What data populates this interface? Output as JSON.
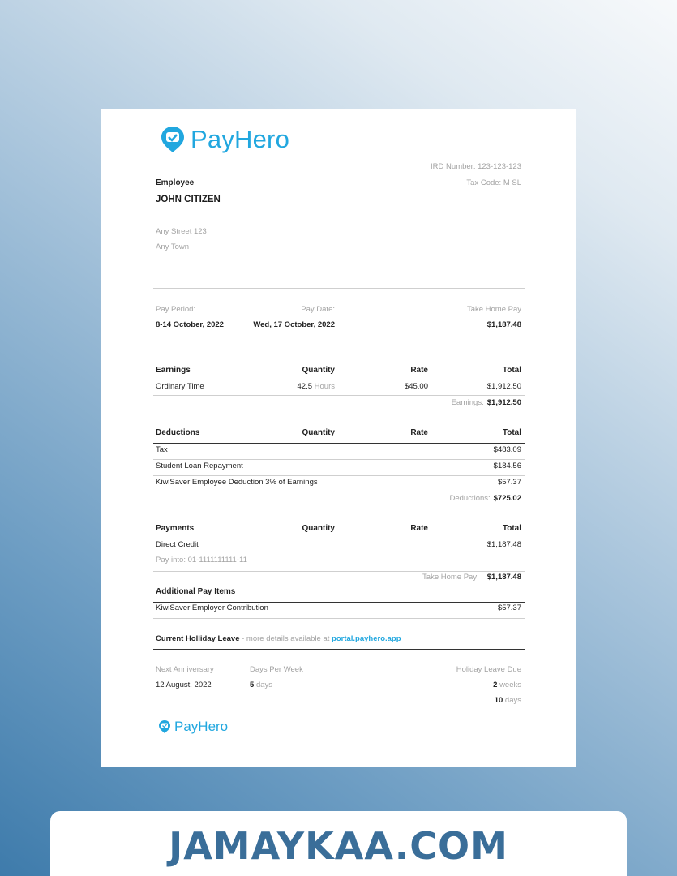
{
  "brand": {
    "name": "PayHero",
    "accent": "#21a7df"
  },
  "employee": {
    "label": "Employee",
    "name": "JOHN CITIZEN",
    "address_line1": "Any Street 123",
    "address_line2": "Any Town"
  },
  "tax": {
    "ird": "IRD Number: 123-123-123",
    "code": "Tax Code: M SL"
  },
  "period": {
    "pay_period_label": "Pay Period:",
    "pay_period_value": "8-14 October, 2022",
    "pay_date_label": "Pay Date:",
    "pay_date_value": "Wed, 17 October, 2022",
    "take_home_label": "Take Home Pay",
    "take_home_value": "$1,187.48"
  },
  "earnings": {
    "headers": [
      "Earnings",
      "Quantity",
      "Rate",
      "Total"
    ],
    "rows": [
      {
        "desc": "Ordinary Time",
        "qty": "42.5",
        "qty_unit": "Hours",
        "rate": "$45.00",
        "total": "$1,912.50"
      }
    ],
    "subtotal_label": "Earnings:",
    "subtotal_value": "$1,912.50"
  },
  "deductions": {
    "headers": [
      "Deductions",
      "Quantity",
      "Rate",
      "Total"
    ],
    "rows": [
      {
        "desc": "Tax",
        "total": "$483.09"
      },
      {
        "desc": "Student Loan Repayment",
        "total": "$184.56"
      },
      {
        "desc": "KiwiSaver Employee Deduction 3% of Earnings",
        "total": "$57.37"
      }
    ],
    "subtotal_label": "Deductions:",
    "subtotal_value": "$725.02"
  },
  "payments": {
    "headers": [
      "Payments",
      "Quantity",
      "Rate",
      "Total"
    ],
    "rows": [
      {
        "desc": "Direct Credit",
        "total": "$1,187.48",
        "note": "Pay into: 01-1111111111-11"
      }
    ],
    "subtotal_label": "Take Home Pay:",
    "subtotal_value": "$1,187.48"
  },
  "additional": {
    "title": "Additional Pay Items",
    "rows": [
      {
        "desc": "KiwiSaver Employer Contribution",
        "total": "$57.37"
      }
    ]
  },
  "holiday": {
    "title": "Current Holliday Leave",
    "note": "- more details available at",
    "link": "portal.payhero.app",
    "next_anniversary_label": "Next Anniversary",
    "next_anniversary_value": "12 August, 2022",
    "days_per_week_label": "Days Per Week",
    "days_per_week_value": "5",
    "days_unit": "days",
    "leave_due_label": "Holiday Leave Due",
    "leave_due_weeks": "2",
    "weeks_unit": "weeks",
    "leave_due_days": "10",
    "leave_days_unit": "days"
  },
  "banner": {
    "text": "JAMAYKAA.COM"
  },
  "icons": [
    "payhero-logo-icon"
  ]
}
